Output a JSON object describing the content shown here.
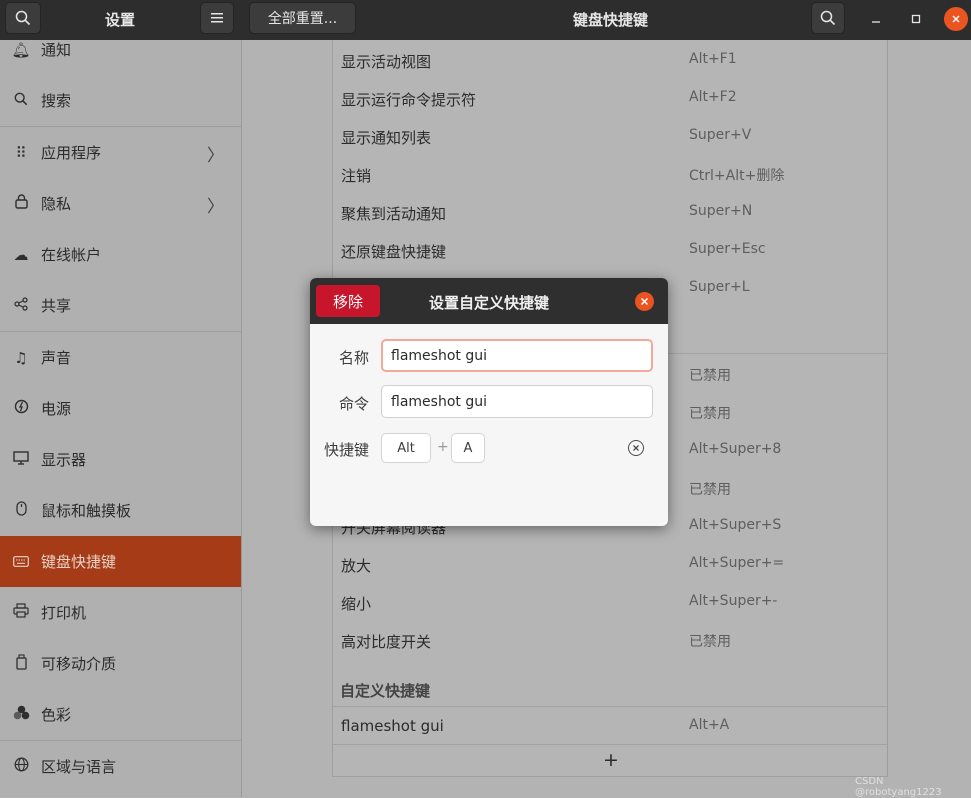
{
  "header": {
    "settings_title": "设置",
    "reset_all_label": "全部重置...",
    "panel_title": "键盘快捷键",
    "search_icon": "search-icon",
    "menu_icon": "hamburger-menu-icon"
  },
  "sidebar": {
    "items": [
      {
        "label": "通知",
        "icon": "bell-icon"
      },
      {
        "label": "搜索",
        "icon": "search-icon"
      },
      {
        "label": "应用程序",
        "icon": "apps-grid-icon",
        "arrow": "〉"
      },
      {
        "label": "隐私",
        "icon": "lock-icon",
        "arrow": "〉"
      },
      {
        "label": "在线帐户",
        "icon": "cloud-icon"
      },
      {
        "label": "共享",
        "icon": "share-icon"
      },
      {
        "label": "声音",
        "icon": "music-note-icon"
      },
      {
        "label": "电源",
        "icon": "power-icon"
      },
      {
        "label": "显示器",
        "icon": "display-icon"
      },
      {
        "label": "鼠标和触摸板",
        "icon": "mouse-icon"
      },
      {
        "label": "键盘快捷键",
        "icon": "keyboard-icon",
        "active": true
      },
      {
        "label": "打印机",
        "icon": "printer-icon"
      },
      {
        "label": "可移动介质",
        "icon": "removable-media-icon"
      },
      {
        "label": "色彩",
        "icon": "color-icon"
      },
      {
        "label": "区域与语言",
        "icon": "globe-icon"
      }
    ]
  },
  "shortcuts": {
    "rows": [
      {
        "name": "显示活动视图",
        "shortcut": "Alt+F1"
      },
      {
        "name": "显示运行命令提示符",
        "shortcut": "Alt+F2"
      },
      {
        "name": "显示通知列表",
        "shortcut": "Super+V"
      },
      {
        "name": "注销",
        "shortcut": "Ctrl+Alt+删除"
      },
      {
        "name": "聚焦到活动通知",
        "shortcut": "Super+N"
      },
      {
        "name": "还原键盘快捷键",
        "shortcut": "Super+Esc"
      },
      {
        "name": "",
        "shortcut": "Super+L"
      },
      {
        "name": "",
        "shortcut": "已禁用"
      },
      {
        "name": "",
        "shortcut": "已禁用"
      },
      {
        "name": "",
        "shortcut": "Alt+Super+8"
      },
      {
        "name": "",
        "shortcut": "已禁用"
      },
      {
        "name": "开关屏幕阅读器",
        "shortcut": "Alt+Super+S"
      },
      {
        "name": "放大",
        "shortcut": "Alt+Super+="
      },
      {
        "name": "缩小",
        "shortcut": "Alt+Super+-"
      },
      {
        "name": "高对比度开关",
        "shortcut": "已禁用"
      }
    ],
    "custom_section_title": "自定义快捷键",
    "custom_rows": [
      {
        "name": "flameshot gui",
        "shortcut": "Alt+A"
      }
    ],
    "add_label": "+"
  },
  "dialog": {
    "title": "设置自定义快捷键",
    "remove_label": "移除",
    "name_label": "名称",
    "name_value": "flameshot gui",
    "command_label": "命令",
    "command_value": "flameshot gui",
    "shortcut_label": "快捷键",
    "key1": "Alt",
    "plus": "+",
    "key2": "A"
  },
  "watermark": "CSDN @robotyang1223"
}
